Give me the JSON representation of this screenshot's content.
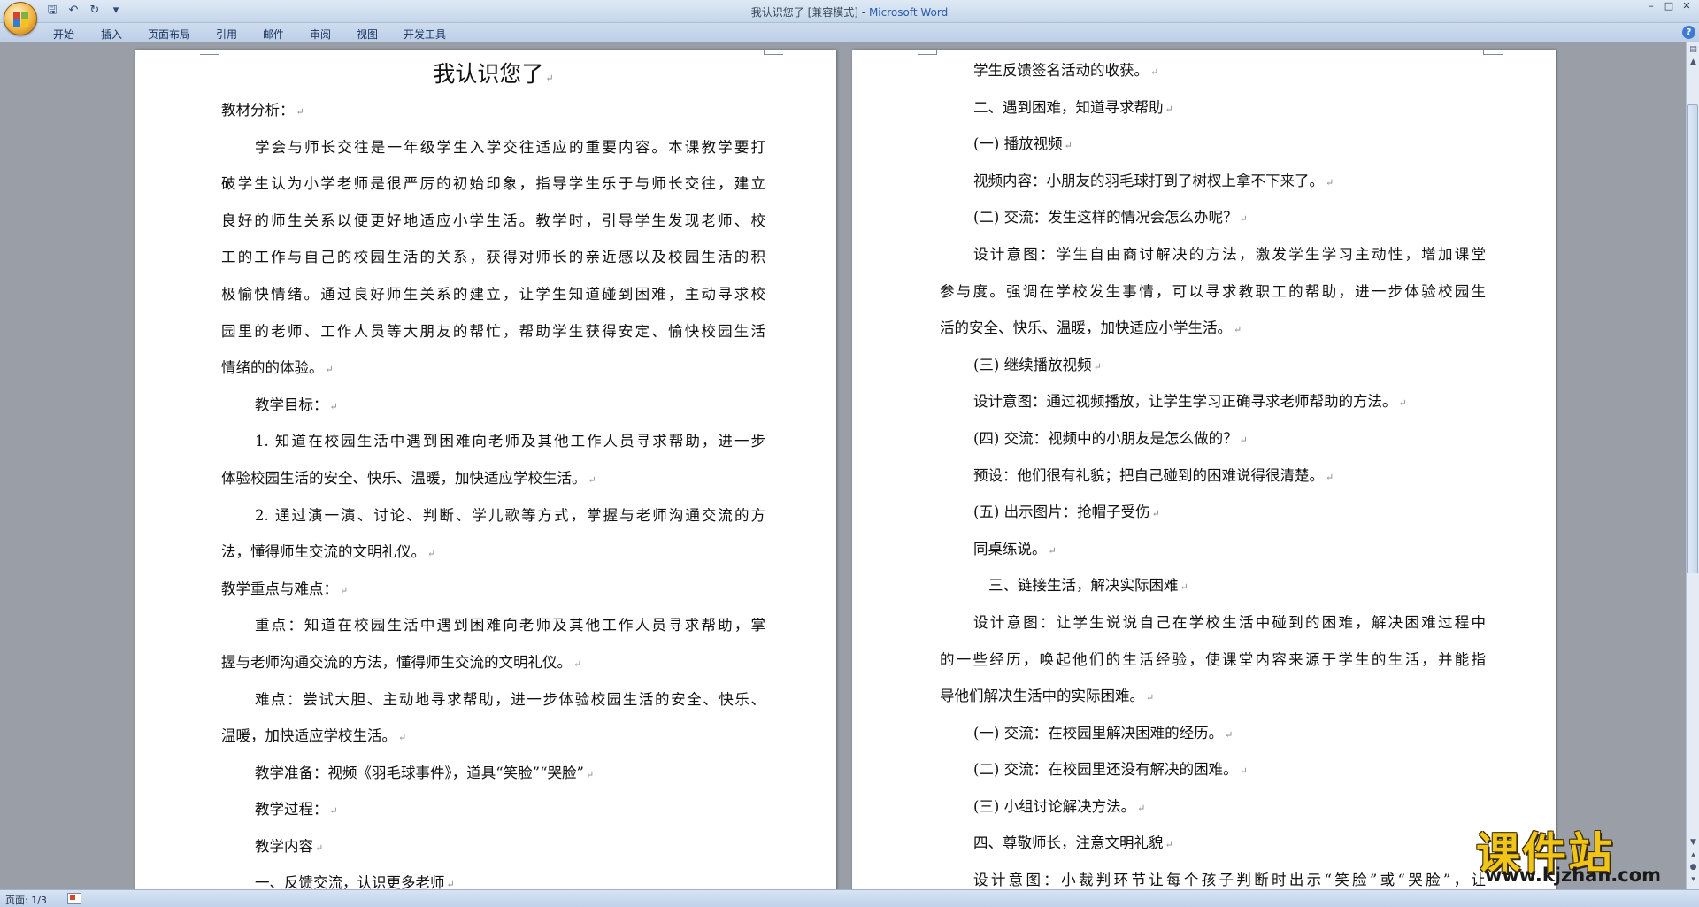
{
  "window": {
    "title": "我认识您了 [兼容模式]",
    "title_sep": " - ",
    "app_name": "Microsoft Word",
    "controls": [
      "minimize-icon",
      "restore-icon",
      "close-icon"
    ]
  },
  "quick_access": {
    "icons": [
      "save-icon",
      "undo-icon",
      "redo-icon",
      "customize-icon"
    ]
  },
  "ribbon": {
    "tabs": [
      "开始",
      "插入",
      "页面布局",
      "引用",
      "邮件",
      "审阅",
      "视图",
      "开发工具"
    ]
  },
  "colors": {
    "accent": "#2a5cac",
    "watermark": "#f0c419"
  },
  "document": {
    "left_page": {
      "title": "我认识您了",
      "lines": [
        "教材分析：",
        "学会与师长交往是一年级学生入学交往适应的重要内容。本课教学要打",
        "破学生认为小学老师是很严厉的初始印象，指导学生乐于与师长交往，建立",
        "良好的师生关系以便更好地适应小学生活。教学时，引导学生发现老师、校",
        "工的工作与自己的校园生活的关系，获得对师长的亲近感以及校园生活的积",
        "极愉快情绪。通过良好师生关系的建立，让学生知道碰到困难，主动寻求校",
        "园里的老师、工作人员等大朋友的帮忙，帮助学生获得安定、愉快校园生活",
        "情绪的的体验。",
        "教学目标：",
        "1. 知道在校园生活中遇到困难向老师及其他工作人员寻求帮助，进一步",
        "体验校园生活的安全、快乐、温暖，加快适应学校生活。",
        "2. 通过演一演、讨论、判断、学儿歌等方式，掌握与老师沟通交流的方",
        "法，懂得师生交流的文明礼仪。",
        "教学重点与难点：",
        "重点：知道在校园生活中遇到困难向老师及其他工作人员寻求帮助，掌",
        "握与老师沟通交流的方法，懂得师生交流的文明礼仪。",
        "难点：尝试大胆、主动地寻求帮助，进一步体验校园生活的安全、快乐、",
        "温暖，加快适应学校生活。",
        "教学准备：视频《羽毛球事件》，道具“笑脸”“哭脸”",
        "教学过程：",
        "教学内容",
        "一、反馈交流，认识更多老师"
      ]
    },
    "right_page": {
      "lines": [
        "学生反馈签名活动的收获。",
        "二、遇到困难，知道寻求帮助",
        "(一) 播放视频",
        "视频内容：小朋友的羽毛球打到了树杈上拿不下来了。",
        "(二) 交流：发生这样的情况会怎么办呢？",
        "设计意图：学生自由商讨解决的方法，激发学生学习主动性，增加课堂",
        "参与度。强调在学校发生事情，可以寻求教职工的帮助，进一步体验校园生",
        "活的安全、快乐、温暖，加快适应小学生活。",
        "(三) 继续播放视频",
        "设计意图：通过视频播放，让学生学习正确寻求老师帮助的方法。",
        "(四) 交流：视频中的小朋友是怎么做的？",
        "预设：他们很有礼貌；把自己碰到的困难说得很清楚。",
        "(五) 出示图片：抢帽子受伤",
        "同桌练说。",
        "三、链接生活，解决实际困难",
        "设计意图：让学生说说自己在学校生活中碰到的困难，解决困难过程中",
        "的一些经历，唤起他们的生活经验，使课堂内容来源于学生的生活，并能指",
        "导他们解决生活中的实际困难。",
        "(一) 交流：在校园里解决困难的经历。",
        "(二) 交流：在校园里还没有解决的困难。",
        "(三) 小组讨论解决方法。",
        "四、尊敬师长，注意文明礼貌",
        "设计意图：小裁判环节让每个孩子判断时出示“笑脸”或“哭脸”，让"
      ]
    }
  },
  "status_bar": {
    "page_info": "页面: 1/3"
  },
  "watermark": {
    "text": "课件站",
    "url": "www.kjzhan.com"
  }
}
